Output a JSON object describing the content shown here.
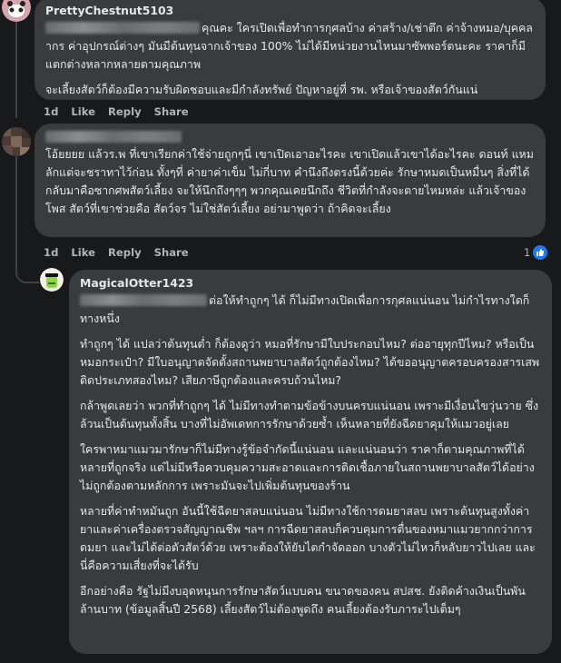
{
  "comments": [
    {
      "author": "PrettyChestnut5103",
      "paragraphs": [
        "คุณคะ ใครเปิดเพื่อทำการกุศลบ้าง ค่าสร้าง/เช่าตึก ค่าจ้างหมอ/บุคคลากร ค่าอุปกรณ์ต่างๆ มันมีต้นทุนจากเจ้าของ 100% ไม่ได้มีหน่วยงานไหนมาซัพพอร์ตนะคะ ราคาก็มีแตกต่างหลากหลายตามคุณภาพ",
        "จะเลี้ยงสัตว์ก็ต้องมีความรับผิดชอบและมีกำลังทรัพย์ ปัญหาอยู่ที่ รพ. หรือเจ้าของสัตว์กันแน่"
      ],
      "actions": {
        "time": "1d",
        "like": "Like",
        "reply": "Reply",
        "share": "Share"
      }
    },
    {
      "author": "",
      "paragraphs": [
        "โอ้ยยยย แล้วร.พ ที่เขาเรียกค่าใช้จ่ายถูกๆนี่ เขาเปิดเอาอะไรคะ เขาเปิดแล้วเขาได้อะไรคะ ดอนท์ แหมลักแต่จะชราทาไว้ก่อน ทั้งๆที่ ค่ายาค่าเข็ม ไม่กี่บาท คำนึงถึงตรงนี้ด้วยค่ะ รักษาหมดเป็นหมื่นๆ สิ่งที่ได้กลับมาคือซากศพสัตว์เลี้ยง จะให้นึกถึงๆๆๆ พวกคุณเคยนึกถึง ชีวิตที่กำลังจะตายไหมหล่ะ แล้วเจ้าของโพส สัตว์ที่เขาช่วยคือ สัตว์จร ไม่ใช่สัตว์เลี้ยง อย่ามาพูดว่า ถ้าคิดจะเลี้ยง"
      ],
      "actions": {
        "time": "1d",
        "like": "Like",
        "reply": "Reply",
        "share": "Share"
      },
      "reaction_count": "1"
    },
    {
      "author": "MagicalOtter1423",
      "paragraphs": [
        "ต่อให้ทำถูกๆ ได้ ก็ไม่มีทางเปิดเพื่อการกุศลแน่นอน ไม่กำไรทางใดก็ทางหนึ่ง",
        "ทำถูกๆ ได้ แปลว่าต้นทุนต่ำ ก็ต้องดูว่า หมอที่รักษามีใบประกอบไหม? ต่ออายุทุกปีไหม? หรือเป็นหมอกระเป๋า? มีใบอนุญาตจัดตั้งสถานพยาบาลสัตว์ถูกต้องไหม? ได้ขออนุญาตครอบครองสารเสพติดประเภทสองไหม? เสียภาษีถูกต้องและครบถ้วนไหม?",
        "กล้าพูดเลยว่า พวกที่ทำถูกๆ ได้ ไม่มีทางทำตามข้อข้างบนครบแน่นอน เพราะมีเงื่อนไขวุ่นวาย ซึ่งล้วนเป็นต้นทุนทั้งสิ้น บางที่ไม่อัพเดทการรักษาด้วยซ้ำ เห็นหลายที่ยังฉีดยาคุมให้แมวอยู่เลย",
        "ใครพาหมาแมวมารักษาก็ไม่มีทางรู้ข้อจำกัดนี้แน่นอน และแน่นอนว่า ราคาก็ตามคุณภาพที่ได้ หลายที่ถูกจริง แต่ไม่มีหรือควบคุมความสะอาดและการติดเชื้อภายในสถานพยาบาลสัตว์ได้อย่างไม่ถูกต้องตามหลักการ เพราะมันจะไปเพิ่มต้นทุนของร้าน",
        "หลายที่ค่าทำหมันถูก อันนี้ใช้ฉีดยาสลบแน่นอน ไม่มีทางใช้การดมยาสลบ เพราะต้นทุนสูงทั้งค่ายาและค่าเครื่องตรวจสัญญาณชีพ ฯลฯ การฉีดยาสลบก็ควบคุมการตื่นของหมาแมวยากกว่าการดมยา และไม่ได้ต่อตัวสัตว์ด้วย เพราะต้องให้ยับไตกำจัดออก บางตัวไม่ไหวก็หลับยาวไปเลย และนี่คือความเสี่ยงที่จะได้รับ",
        "อีกอย่างคือ รัฐไม่มีงบอุดหนุนการรักษาสัตว์แบบคน ขนาดของคน สปสช. ยังติดค้างเงินเป็นพันล้านบาท (ข้อมูลสิ้นปี 2568) เลี้ยงสัตว์ไม่ต้องพูดถึง คนเลี้ยงต้องรับภาระไปเต็มๆ"
      ]
    }
  ],
  "colors": {
    "background": "#18191a",
    "bubble": "#3a3b3c",
    "text": "#e4e6eb",
    "secondary_text": "#b0b3b8",
    "like_blue": "#2078f4"
  },
  "icons": [
    "avatar-panda-icon",
    "avatar-blurred-icon",
    "avatar-frog-icon",
    "like-thumb-icon"
  ]
}
